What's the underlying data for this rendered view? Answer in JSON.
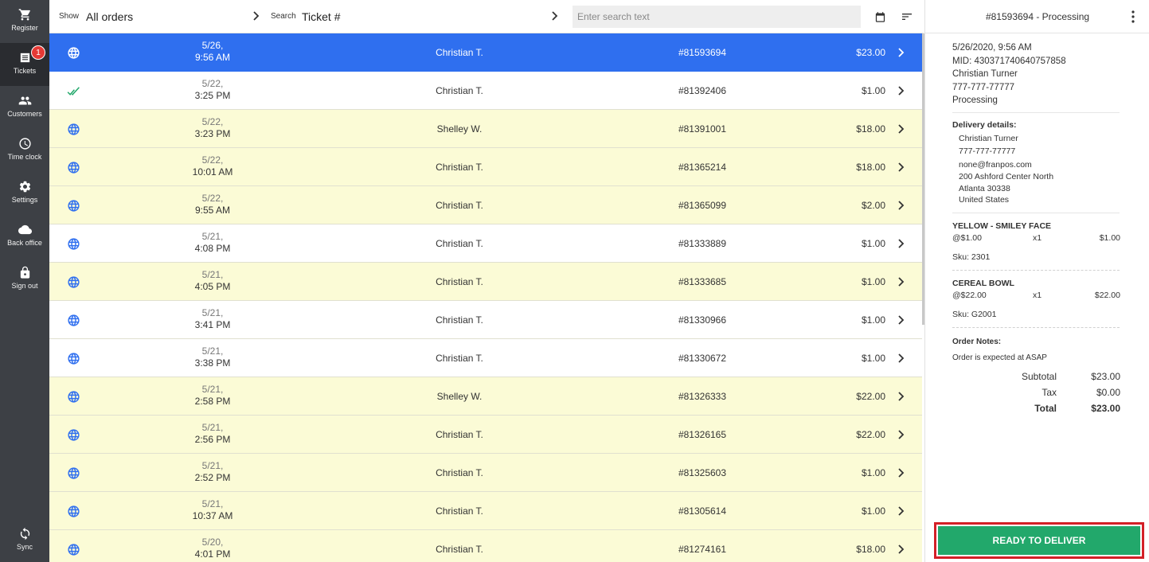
{
  "sidebar": {
    "items": [
      {
        "label": "Register",
        "icon": "cart-icon"
      },
      {
        "label": "Tickets",
        "icon": "tickets-icon",
        "badge": "1"
      },
      {
        "label": "Customers",
        "icon": "customers-icon"
      },
      {
        "label": "Time clock",
        "icon": "clock-icon"
      },
      {
        "label": "Settings",
        "icon": "gear-icon"
      },
      {
        "label": "Back office",
        "icon": "cloud-icon"
      },
      {
        "label": "Sign out",
        "icon": "lock-icon"
      }
    ],
    "sync": {
      "label": "Sync",
      "icon": "sync-icon"
    }
  },
  "toolbar": {
    "show_label": "Show",
    "show_value": "All orders",
    "search_label": "Search",
    "search_field": "Ticket #",
    "search_placeholder": "Enter search text"
  },
  "orders": [
    {
      "status": "web",
      "date": "5/26,",
      "time": "9:56 AM",
      "customer": "Christian T.",
      "ticket": "#81593694",
      "amount": "$23.00",
      "selected": true,
      "highlight": false
    },
    {
      "status": "done",
      "date": "5/22,",
      "time": "3:25 PM",
      "customer": "Christian T.",
      "ticket": "#81392406",
      "amount": "$1.00",
      "selected": false,
      "highlight": false
    },
    {
      "status": "web",
      "date": "5/22,",
      "time": "3:23 PM",
      "customer": "Shelley W.",
      "ticket": "#81391001",
      "amount": "$18.00",
      "selected": false,
      "highlight": true
    },
    {
      "status": "web",
      "date": "5/22,",
      "time": "10:01 AM",
      "customer": "Christian T.",
      "ticket": "#81365214",
      "amount": "$18.00",
      "selected": false,
      "highlight": true
    },
    {
      "status": "web",
      "date": "5/22,",
      "time": "9:55 AM",
      "customer": "Christian T.",
      "ticket": "#81365099",
      "amount": "$2.00",
      "selected": false,
      "highlight": true
    },
    {
      "status": "web",
      "date": "5/21,",
      "time": "4:08 PM",
      "customer": "Christian T.",
      "ticket": "#81333889",
      "amount": "$1.00",
      "selected": false,
      "highlight": false
    },
    {
      "status": "web",
      "date": "5/21,",
      "time": "4:05 PM",
      "customer": "Christian T.",
      "ticket": "#81333685",
      "amount": "$1.00",
      "selected": false,
      "highlight": true
    },
    {
      "status": "web",
      "date": "5/21,",
      "time": "3:41 PM",
      "customer": "Christian T.",
      "ticket": "#81330966",
      "amount": "$1.00",
      "selected": false,
      "highlight": false
    },
    {
      "status": "web",
      "date": "5/21,",
      "time": "3:38 PM",
      "customer": "Christian T.",
      "ticket": "#81330672",
      "amount": "$1.00",
      "selected": false,
      "highlight": false
    },
    {
      "status": "web",
      "date": "5/21,",
      "time": "2:58 PM",
      "customer": "Shelley W.",
      "ticket": "#81326333",
      "amount": "$22.00",
      "selected": false,
      "highlight": true
    },
    {
      "status": "web",
      "date": "5/21,",
      "time": "2:56 PM",
      "customer": "Christian T.",
      "ticket": "#81326165",
      "amount": "$22.00",
      "selected": false,
      "highlight": true
    },
    {
      "status": "web",
      "date": "5/21,",
      "time": "2:52 PM",
      "customer": "Christian T.",
      "ticket": "#81325603",
      "amount": "$1.00",
      "selected": false,
      "highlight": true
    },
    {
      "status": "web",
      "date": "5/21,",
      "time": "10:37 AM",
      "customer": "Christian T.",
      "ticket": "#81305614",
      "amount": "$1.00",
      "selected": false,
      "highlight": true
    },
    {
      "status": "web",
      "date": "5/20,",
      "time": "4:01 PM",
      "customer": "Christian T.",
      "ticket": "#81274161",
      "amount": "$18.00",
      "selected": false,
      "highlight": true
    }
  ],
  "detail": {
    "title": "#81593694 - Processing",
    "datetime": "5/26/2020, 9:56 AM",
    "mid": "MID: 430371740640757858",
    "customer_name": "Christian Turner",
    "phone": "777-777-77777",
    "status": "Processing",
    "delivery_heading": "Delivery details:",
    "delivery": {
      "name": "Christian Turner",
      "phone": "777-777-77777",
      "email": "none@franpos.com",
      "street": "200 Ashford Center North",
      "city": "Atlanta 30338",
      "country": "United States"
    },
    "items": [
      {
        "name": "YELLOW - SMILEY FACE",
        "unit": "@$1.00",
        "qty": "x1",
        "total": "$1.00",
        "sku": "Sku: 2301"
      },
      {
        "name": "CEREAL BOWL",
        "unit": "@$22.00",
        "qty": "x1",
        "total": "$22.00",
        "sku": "Sku: G2001"
      }
    ],
    "notes_heading": "Order Notes:",
    "notes": "Order is expected at ASAP",
    "subtotal_label": "Subtotal",
    "subtotal": "$23.00",
    "tax_label": "Tax",
    "tax": "$0.00",
    "total_label": "Total",
    "total": "$23.00",
    "action_label": "READY TO DELIVER"
  },
  "colors": {
    "sidebar": "#3d4045",
    "selected_row": "#2f6fef",
    "highlight_row": "#fbfbd6",
    "globe": "#2f6fef",
    "done_check": "#22a86b",
    "action_button": "#22a86b",
    "action_outline": "#d32027"
  }
}
